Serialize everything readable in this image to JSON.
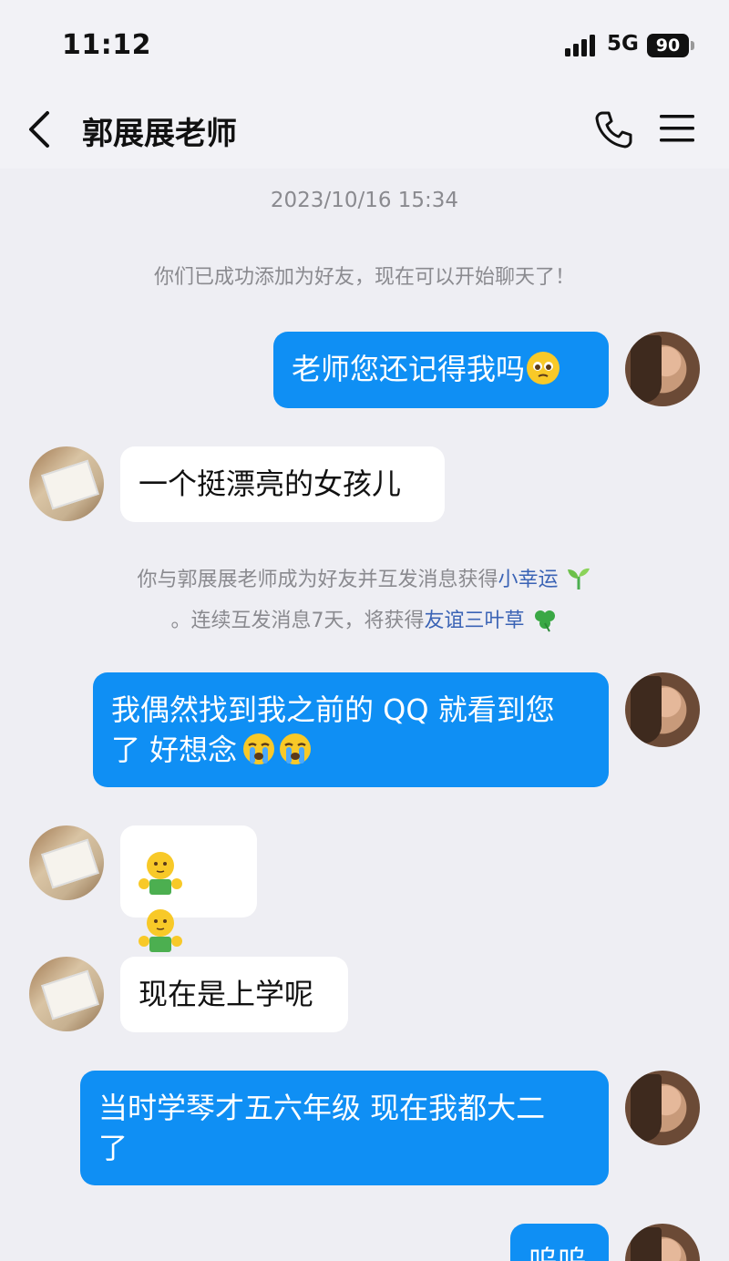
{
  "status_bar": {
    "time": "11:12",
    "network": "5G",
    "battery": "90"
  },
  "header": {
    "title": "郭展展老师"
  },
  "chat": {
    "timestamp": "2023/10/16 15:34",
    "system_added": "你们已成功添加为好友，现在可以开始聊天了！",
    "system_luck_line1_prefix": "你与郭展展老师成为好友并互发消息获得",
    "system_luck_link1": "小幸运",
    "system_luck_line2_prefix": "。连续互发消息7天，将获得",
    "system_luck_link2": "友谊三叶草",
    "messages": [
      {
        "from": "me",
        "text": "老师您还记得我吗"
      },
      {
        "from": "teacher",
        "text": "一个挺漂亮的女孩儿"
      },
      {
        "from": "me",
        "text_line1": "我偶然找到我之前的 QQ 就看到您",
        "text_line2": "了 好想念"
      },
      {
        "from": "teacher",
        "text": ""
      },
      {
        "from": "teacher",
        "text": "现在是上学呢"
      },
      {
        "from": "me",
        "text_line1": "当时学琴才五六年级 现在我都大二",
        "text_line2": "了"
      },
      {
        "from": "me",
        "text": "呜呜"
      }
    ]
  },
  "icons": [
    "back-icon",
    "phone-icon",
    "menu-icon",
    "signal-icon",
    "pleading-face-emoji",
    "crying-face-emoji",
    "hug-emoji",
    "sprout-emoji",
    "shamrock-emoji"
  ],
  "colors": {
    "out_bubble": "#0f8ff4",
    "in_bubble": "#ffffff",
    "background": "#eeeef3",
    "link": "#3a63b5"
  }
}
